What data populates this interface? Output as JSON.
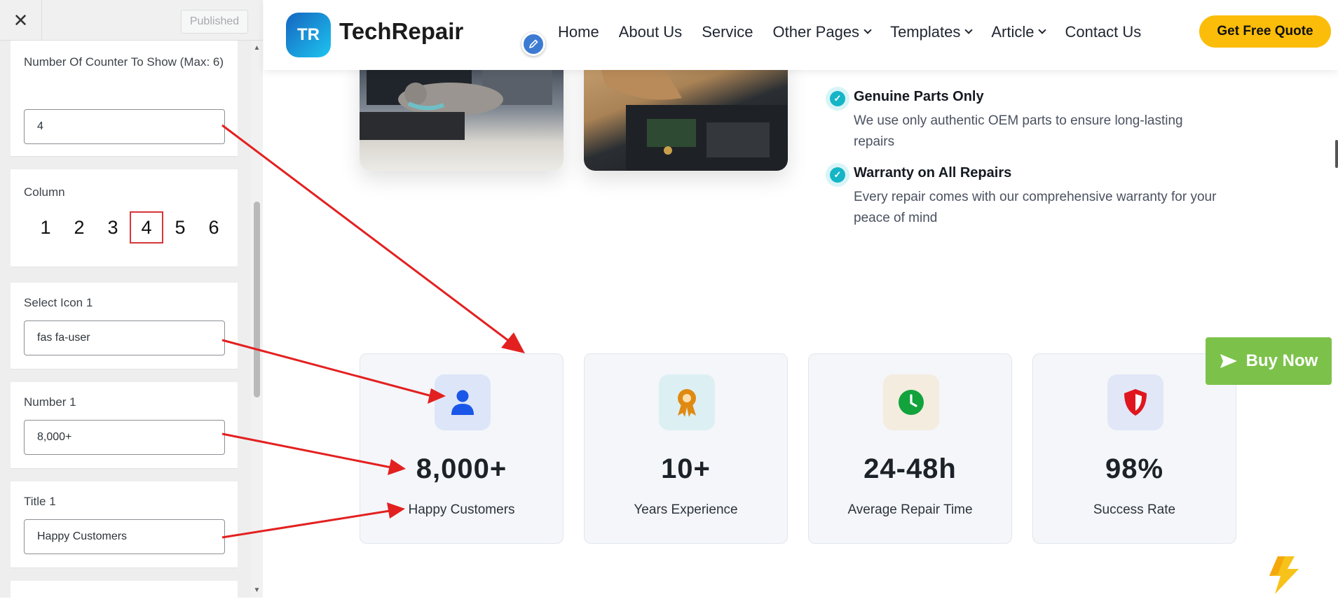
{
  "customizer": {
    "close_icon": "close-icon",
    "publish_label": "Published",
    "counter_count": {
      "label": "Number Of Counter To Show (Max: 6)",
      "value": "4"
    },
    "column": {
      "label": "Column",
      "options": [
        "1",
        "2",
        "3",
        "4",
        "5",
        "6"
      ],
      "selected": "4"
    },
    "icon1": {
      "label": "Select Icon 1",
      "value": "fas fa-user"
    },
    "number1": {
      "label": "Number 1",
      "value": "8,000+"
    },
    "title1": {
      "label": "Title 1",
      "value": "Happy Customers"
    }
  },
  "header": {
    "logo_badge": "TR",
    "logo_text": "TechRepair",
    "nav": [
      {
        "label": "Home",
        "dropdown": false
      },
      {
        "label": "About Us",
        "dropdown": false
      },
      {
        "label": "Service",
        "dropdown": false
      },
      {
        "label": "Other Pages",
        "dropdown": true
      },
      {
        "label": "Templates",
        "dropdown": true
      },
      {
        "label": "Article",
        "dropdown": true
      },
      {
        "label": "Contact Us",
        "dropdown": false
      }
    ],
    "cta": "Get Free Quote"
  },
  "features": [
    {
      "title": "Genuine Parts Only",
      "desc": "We use only authentic OEM parts to ensure long-lasting repairs"
    },
    {
      "title": "Warranty on All Repairs",
      "desc": "Every repair comes with our comprehensive warranty for your peace of mind"
    }
  ],
  "counters": [
    {
      "icon": "user-icon",
      "number": "8,000+",
      "title": "Happy Customers",
      "icon_bg": "#dde6f8",
      "icon_color": "#1a56e8"
    },
    {
      "icon": "award-icon",
      "number": "10+",
      "title": "Years Experience",
      "icon_bg": "#dcf0f4",
      "icon_color": "#e08a12"
    },
    {
      "icon": "clock-icon",
      "number": "24-48h",
      "title": "Average Repair Time",
      "icon_bg": "#f4ecdf",
      "icon_color": "#12a33c"
    },
    {
      "icon": "shield-icon",
      "number": "98%",
      "title": "Success Rate",
      "icon_bg": "#e1e7f6",
      "icon_color": "#e0161e"
    }
  ],
  "buy_now": "Buy Now",
  "colors": {
    "accent": "#fbbd0a",
    "buy": "#7cc24a",
    "annotation": "#e32020",
    "check": "#14b5c7"
  }
}
